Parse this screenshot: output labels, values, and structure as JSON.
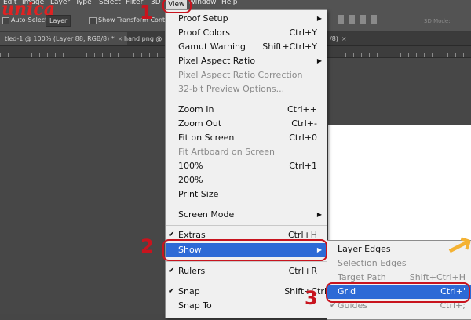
{
  "logo": "unica",
  "menubar": [
    "Edit",
    "Image",
    "Layer",
    "Type",
    "Select",
    "Filter",
    "3D",
    "View",
    "Window",
    "Help"
  ],
  "options": {
    "auto_select": "Auto-Select:",
    "layer_select": "Layer",
    "show_transform": "Show Transform Controls",
    "mode_3d": "3D Mode:"
  },
  "tabs": [
    {
      "label": "tled-1 @ 100% (Layer 88, RGB/8) *",
      "close": "×"
    },
    {
      "label": "hand.png @",
      "close": "×"
    },
    {
      "label": "/8)",
      "close": "×"
    }
  ],
  "view_menu": {
    "items": [
      {
        "label": "Proof Setup",
        "shortcut": "",
        "submenu": true
      },
      {
        "label": "Proof Colors",
        "shortcut": "Ctrl+Y"
      },
      {
        "label": "Gamut Warning",
        "shortcut": "Shift+Ctrl+Y"
      },
      {
        "label": "Pixel Aspect Ratio",
        "shortcut": "",
        "submenu": true
      },
      {
        "label": "Pixel Aspect Ratio Correction",
        "shortcut": "",
        "disabled": true
      },
      {
        "label": "32-bit Preview Options...",
        "shortcut": "",
        "disabled": true
      },
      {
        "label": "Zoom In",
        "shortcut": "Ctrl++"
      },
      {
        "label": "Zoom Out",
        "shortcut": "Ctrl+-"
      },
      {
        "label": "Fit on Screen",
        "shortcut": "Ctrl+0"
      },
      {
        "label": "Fit Artboard on Screen",
        "shortcut": "",
        "disabled": true
      },
      {
        "label": "100%",
        "shortcut": "Ctrl+1"
      },
      {
        "label": "200%",
        "shortcut": ""
      },
      {
        "label": "Print Size",
        "shortcut": ""
      },
      {
        "label": "Screen Mode",
        "shortcut": "",
        "submenu": true
      },
      {
        "label": "Extras",
        "shortcut": "Ctrl+H",
        "checked": true
      },
      {
        "label": "Show",
        "shortcut": "",
        "submenu": true,
        "highlighted": true
      },
      {
        "label": "Rulers",
        "shortcut": "Ctrl+R",
        "checked": true
      },
      {
        "label": "Snap",
        "shortcut": "Shift+Ctrl",
        "checked": true
      },
      {
        "label": "Snap To",
        "shortcut": ""
      }
    ]
  },
  "show_submenu": {
    "items": [
      {
        "label": "Layer Edges",
        "shortcut": ""
      },
      {
        "label": "Selection Edges",
        "shortcut": "",
        "disabled": true
      },
      {
        "label": "Target Path",
        "shortcut": "Shift+Ctrl+H",
        "disabled": true
      },
      {
        "label": "Grid",
        "shortcut": "Ctrl+'",
        "highlighted": true
      },
      {
        "label": "Guides",
        "shortcut": "Ctrl+;",
        "checked": true,
        "disabled": true
      }
    ]
  },
  "annotations": {
    "step1": "1",
    "step2": "2",
    "step3": "3"
  },
  "colors": {
    "annotation": "#c8141e",
    "highlight": "#2d6ad6",
    "arrow": "#f4b233"
  }
}
